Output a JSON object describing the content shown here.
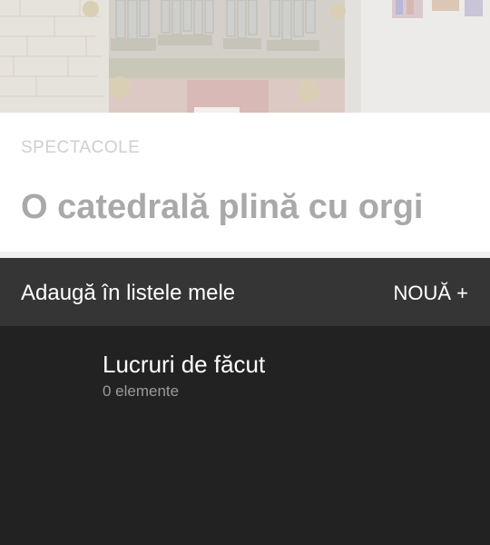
{
  "article": {
    "category": "SPECTACOLE",
    "title": "O catedrală plină cu orgi"
  },
  "sheet": {
    "title": "Adaugă în listele mele",
    "new_button_label": "NOUĂ +",
    "lists": [
      {
        "name": "Lucruri de făcut",
        "count_label": "0 elemente"
      }
    ]
  },
  "colors": {
    "sheet_header": "#353535",
    "sheet_body": "#222222",
    "title_dimmed": "#a9a9a9",
    "category_dimmed": "#cfcfcf"
  },
  "icons": {
    "hero": "pipe-organ-photo"
  }
}
